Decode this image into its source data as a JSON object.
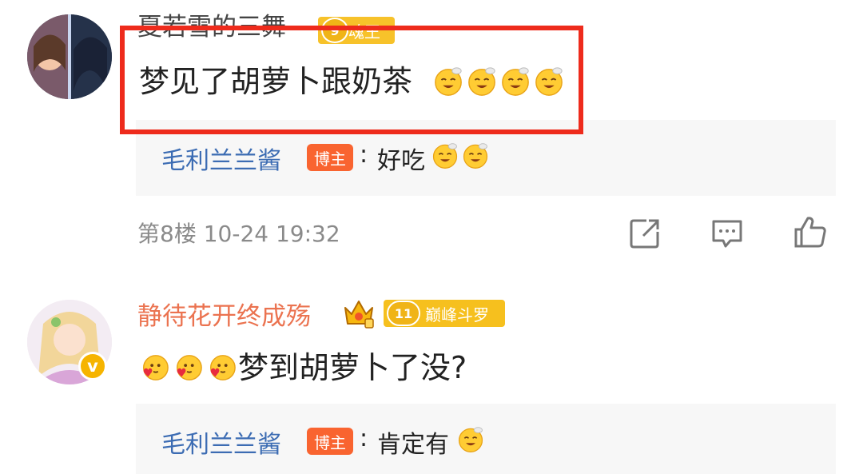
{
  "comments": [
    {
      "username": "夏若雪的三舞",
      "level_badge": {
        "number": "9",
        "title": "魂王"
      },
      "text": "梦见了胡萝卜跟奶茶",
      "emojis": [
        "sleepy-emoji",
        "sleepy-emoji",
        "sleepy-emoji",
        "sleepy-emoji"
      ],
      "reply": {
        "author": "毛利兰兰酱",
        "author_badge": "博主",
        "separator": ":",
        "text": "好吃",
        "emojis": [
          "sleepy-emoji",
          "sleepy-emoji"
        ]
      },
      "floor": "第8楼",
      "timestamp": "10-24 19:32"
    },
    {
      "username": "静待花开终成殇",
      "level_badge": {
        "number": "11",
        "title": "巅峰斗罗"
      },
      "leading_emojis": [
        "love-emoji",
        "love-emoji",
        "love-emoji"
      ],
      "text": "梦到胡萝卜了没?",
      "reply": {
        "author": "毛利兰兰酱",
        "author_badge": "博主",
        "separator": ":",
        "text": "肯定有",
        "emojis": [
          "sleepy-emoji"
        ]
      }
    }
  ],
  "icons": {
    "actions": [
      "share-icon",
      "comment-icon",
      "like-icon"
    ],
    "verified": "verified-v-icon",
    "vip": "crown-icon"
  },
  "colors": {
    "username": "#eb7350",
    "reply_author": "#3c6cb3",
    "author_badge": "#f96430",
    "level_badge": "#f6c01e",
    "highlight_box": "#ee2b1c",
    "reply_background": "#f7f7f7",
    "meta_text": "#8a8a8a"
  },
  "verified_badge": "v"
}
